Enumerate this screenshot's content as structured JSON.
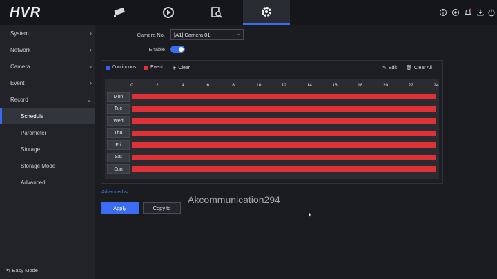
{
  "app": {
    "logo": "HVR"
  },
  "top_tabs": [
    {
      "name": "camera",
      "icon": "camera-icon"
    },
    {
      "name": "playback",
      "icon": "playback-icon"
    },
    {
      "name": "search",
      "icon": "file-search-icon"
    },
    {
      "name": "settings",
      "icon": "gear-icon",
      "active": true
    }
  ],
  "top_right_icons": [
    "info-icon",
    "record-status-icon",
    "bell-icon",
    "download-icon",
    "power-icon"
  ],
  "sidebar": {
    "items": [
      {
        "label": "System",
        "has_chevron": true,
        "chevron": "›"
      },
      {
        "label": "Network",
        "has_chevron": true,
        "chevron": "›"
      },
      {
        "label": "Camera",
        "has_chevron": true,
        "chevron": "›"
      },
      {
        "label": "Event",
        "has_chevron": true,
        "chevron": "›"
      },
      {
        "label": "Record",
        "has_chevron": true,
        "chevron": "⌄"
      },
      {
        "label": "Schedule",
        "active": true
      },
      {
        "label": "Parameter"
      },
      {
        "label": "Storage"
      },
      {
        "label": "Storage Mode"
      },
      {
        "label": "Advanced"
      }
    ],
    "easy_mode": "Easy Mode"
  },
  "form": {
    "camera_label": "Camera No.",
    "camera_value": "[A1] Camera 01",
    "enable_label": "Enable",
    "enabled": true
  },
  "schedule": {
    "legend": [
      {
        "label": "Continuous",
        "color": "#3a5cf4"
      },
      {
        "label": "Event",
        "color": "#e23037"
      }
    ],
    "clear_label": "Clear",
    "edit_label": "Edit",
    "clear_all_label": "Clear All",
    "hours": [
      "0",
      "2",
      "4",
      "6",
      "8",
      "10",
      "12",
      "14",
      "16",
      "18",
      "20",
      "22",
      "24"
    ],
    "days": [
      "Mon",
      "Tue",
      "Wed",
      "Thu",
      "Fri",
      "Sat",
      "Sun"
    ],
    "event_color": "#e23037"
  },
  "advanced_link": "Advanced>>",
  "buttons": {
    "apply": "Apply",
    "copy": "Copy to"
  },
  "watermark": "Akcommunication294"
}
